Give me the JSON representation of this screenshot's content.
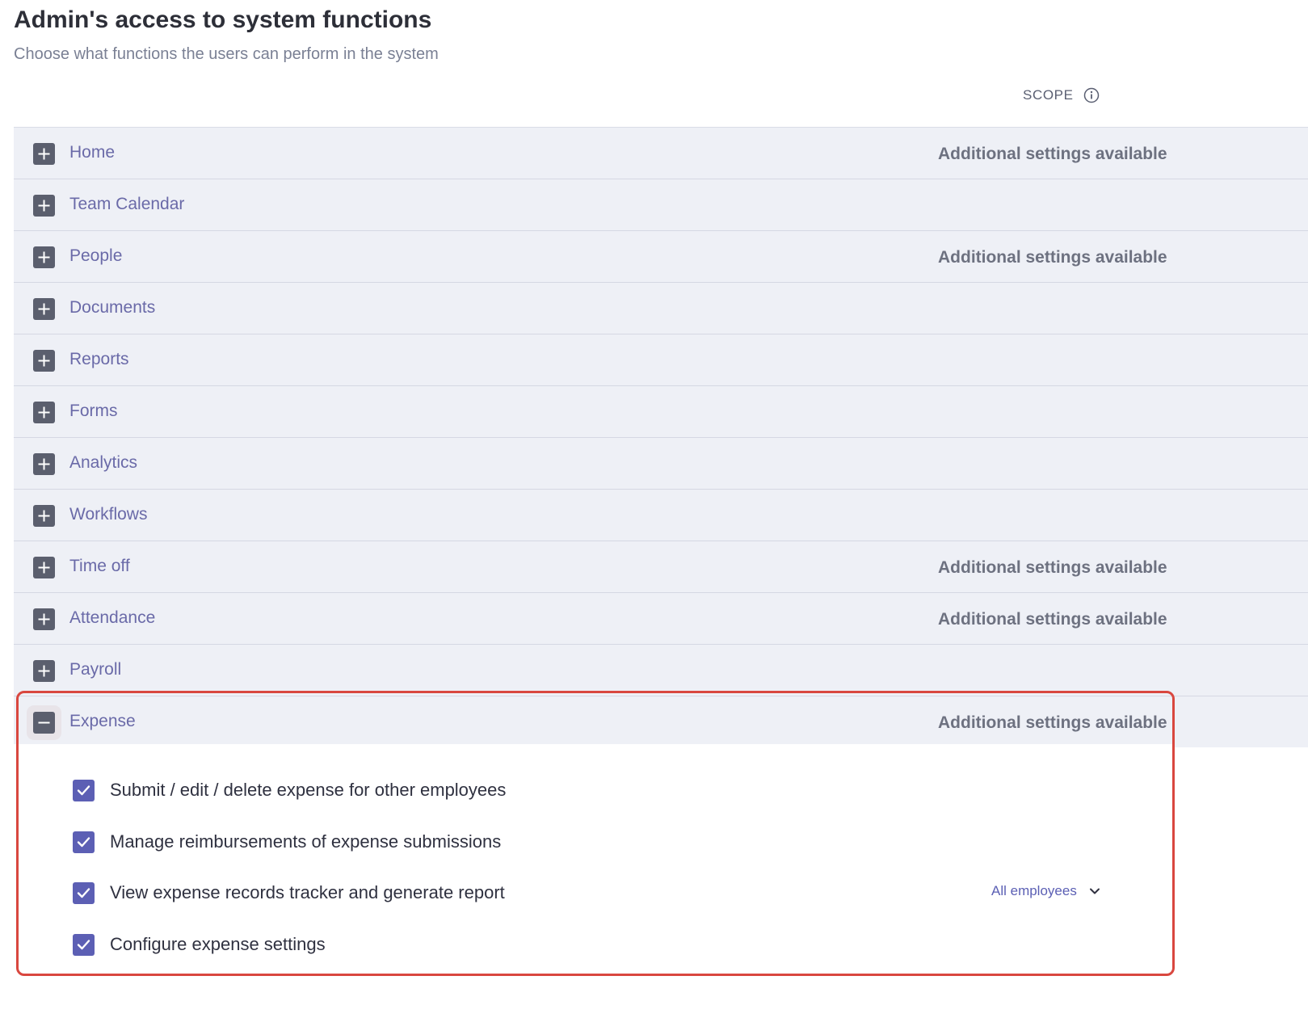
{
  "header": {
    "title": "Admin's access to system functions",
    "subtitle": "Choose what functions the users can perform in the system",
    "scope_label": "SCOPE"
  },
  "rows": [
    {
      "label": "Home",
      "extra": "Additional settings available"
    },
    {
      "label": "Team Calendar",
      "extra": ""
    },
    {
      "label": "People",
      "extra": "Additional settings available"
    },
    {
      "label": "Documents",
      "extra": ""
    },
    {
      "label": "Reports",
      "extra": ""
    },
    {
      "label": "Forms",
      "extra": ""
    },
    {
      "label": "Analytics",
      "extra": ""
    },
    {
      "label": "Workflows",
      "extra": ""
    },
    {
      "label": "Time off",
      "extra": "Additional settings available"
    },
    {
      "label": "Attendance",
      "extra": "Additional settings available"
    },
    {
      "label": "Payroll",
      "extra": ""
    },
    {
      "label": "Expense",
      "extra": "Additional settings available",
      "expanded": true
    }
  ],
  "expense": {
    "permissions": [
      {
        "label": "Submit / edit / delete expense for other employees",
        "checked": true
      },
      {
        "label": "Manage reimbursements of expense submissions",
        "checked": true
      },
      {
        "label": "View expense records tracker and generate report",
        "checked": true,
        "scope": "All employees"
      },
      {
        "label": "Configure expense settings",
        "checked": true
      }
    ]
  },
  "icons": {
    "collapsed": "plus-square-icon",
    "expanded": "minus-square-icon",
    "check": "check-icon",
    "info": "info-circle-icon",
    "dropdown": "chevron-down-icon"
  },
  "colors": {
    "row_bg": "#eef0f6",
    "link": "#6a6aa8",
    "accent": "#5c5fb4",
    "highlight": "#d9473f"
  }
}
